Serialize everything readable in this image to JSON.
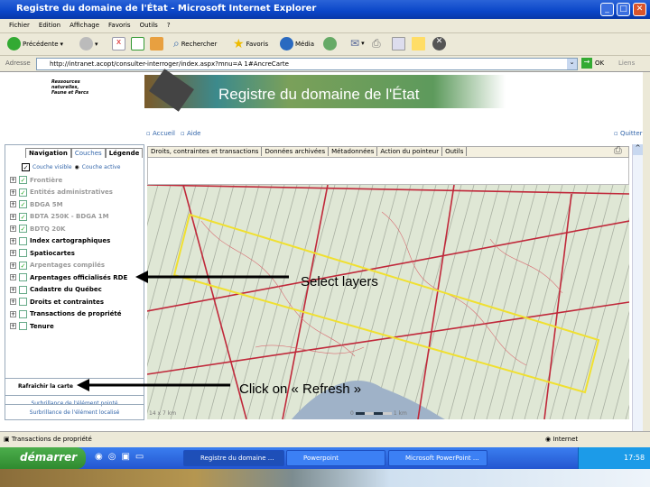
{
  "window": {
    "title": "Registre du domaine de l'État - Microsoft Internet Explorer"
  },
  "menu": [
    "Fichier",
    "Edition",
    "Affichage",
    "Favoris",
    "Outils",
    "?"
  ],
  "toolbar": {
    "back": "Précédente",
    "search": "Rechercher",
    "favorites": "Favoris",
    "media": "Média"
  },
  "address": {
    "label": "Adresse",
    "url": "http://intranet.acopt/consulter-interroger/index.aspx?mnu=A 1#AncreCarte",
    "go": "OK",
    "links": "Liens"
  },
  "banner": {
    "ministry": "Ressources naturelles, Faune et Parcs",
    "title": "Registre du domaine de l'État"
  },
  "toplinks": {
    "home": "Accueil",
    "help": "Aide",
    "quit": "Quitter"
  },
  "leftpanel": {
    "tabs": [
      "Navigation",
      "Couches",
      "Légende"
    ],
    "legend_visible": "Couche visible",
    "legend_active": "Couche active",
    "layers": [
      {
        "label": "Frontière",
        "checked": true,
        "dim": true
      },
      {
        "label": "Entités administratives",
        "checked": true,
        "dim": true
      },
      {
        "label": "BDGA 5M",
        "checked": true,
        "dim": true
      },
      {
        "label": "BDTA 250K - BDGA 1M",
        "checked": true,
        "dim": true
      },
      {
        "label": "BDTQ 20K",
        "checked": true,
        "dim": true
      },
      {
        "label": "Index cartographiques",
        "checked": false,
        "dim": false
      },
      {
        "label": "Spatiocartes",
        "checked": false,
        "dim": false
      },
      {
        "label": "Arpentages compilés",
        "checked": true,
        "dim": true
      },
      {
        "label": "Arpentages officialisés RDE",
        "checked": false,
        "dim": false
      },
      {
        "label": "Cadastre du Québec",
        "checked": false,
        "dim": false
      },
      {
        "label": "Droits et contraintes",
        "checked": false,
        "dim": false
      },
      {
        "label": "Transactions de propriété",
        "checked": false,
        "dim": false
      },
      {
        "label": "Tenure",
        "checked": false,
        "dim": false
      }
    ],
    "refresh": "Rafraîchir la carte",
    "highlight_pointed": "Surbrillance de l'élément pointé",
    "highlight_located": "Surbrillance de l'élément localisé"
  },
  "maptabs": [
    "Droits, contraintes et transactions",
    "Données archivées",
    "Métadonnées",
    "Action du pointeur",
    "Outils"
  ],
  "map": {
    "extent": "14 x 7 km",
    "scale_start": "0",
    "scale_end": "1 km"
  },
  "annotations": {
    "select": "Select layers",
    "refresh": "Click on « Refresh »"
  },
  "status": {
    "text": "Transactions de propriété",
    "zone": "Internet"
  },
  "taskbar": {
    "start": "démarrer",
    "tasks": [
      "Registre du domaine ...",
      "Powerpoint",
      "Microsoft PowerPoint ..."
    ],
    "clock": "17:58"
  }
}
